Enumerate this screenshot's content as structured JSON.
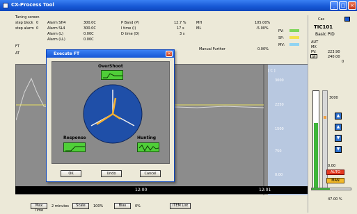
{
  "window": {
    "title": "CX-Process Tool"
  },
  "info": {
    "screen": "Tuning screen",
    "left_rows": [
      {
        "a": "step block",
        "b": "0",
        "c": "Alarm SH4",
        "d": "300.0C"
      },
      {
        "a": "step alarm",
        "b": "0",
        "c": "Alarm SL4",
        "d": "300.0C"
      },
      {
        "a": "",
        "b": "",
        "c": "Alarm (L)",
        "d": "0.00C"
      },
      {
        "a": "",
        "b": "",
        "c": "Alarm (LL)",
        "d": "0.00C"
      }
    ],
    "ft_label": "FT",
    "at_label": "AT",
    "pid_rows": [
      {
        "name": "P Band (P)",
        "value": "12.7 %"
      },
      {
        "name": "I time (I)",
        "value": "17 s"
      },
      {
        "name": "D time (D)",
        "value": "3 s"
      }
    ],
    "limit_rows": [
      {
        "name": "MH",
        "value": "105.00%"
      },
      {
        "name": "ML",
        "value": "-5.00%"
      }
    ],
    "manual_label": "Manual Further",
    "manual_value": "0.00%",
    "legend": [
      {
        "label": "PV:",
        "color": "#7ed65a"
      },
      {
        "label": "SP:",
        "color": "#f2e24c"
      },
      {
        "label": "MV:",
        "color": "#8fd3f2"
      }
    ]
  },
  "trend": {
    "axis_labels": [
      "3000",
      "2250",
      "1500",
      "750",
      "0.00"
    ],
    "header_value": "[ C ]",
    "time_labels": [
      "12:00",
      "12:01"
    ]
  },
  "dialog": {
    "title": "Execute FT",
    "overshoot_label": "OverShoot",
    "response_label": "Response",
    "hunting_label": "Hunting",
    "ok": "OK",
    "undo": "Undo",
    "cancel": "Cancel"
  },
  "bottom": {
    "max_time_label": "Max Time",
    "max_time_value": "2 minutes",
    "scale_label": "Scale",
    "scale_value": "100%",
    "bias_label": "Bias",
    "bias_value": "0%",
    "item_list_label": "ITEM List"
  },
  "right": {
    "mode": "Cas",
    "tag": "TIC101",
    "type": "Basic PID",
    "rows": [
      {
        "label": "AUT",
        "value": ""
      },
      {
        "label": "MX",
        "value": ""
      },
      {
        "label": "PV:",
        "value": "223.90"
      },
      {
        "label": "SP",
        "value": "240.00"
      },
      {
        "label": "",
        "value": "0"
      }
    ],
    "bar_top": "3000",
    "bar_mid": "0.00",
    "auto": "AUTO",
    "man": "MAN",
    "mv_value": "47.00 %"
  }
}
